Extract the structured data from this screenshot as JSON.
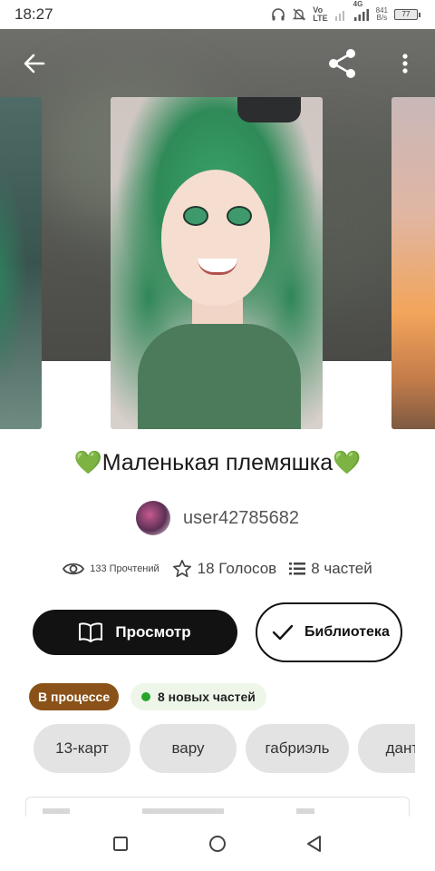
{
  "status_bar": {
    "time": "18:27",
    "volte": "Vo\nLTE",
    "network": "4G",
    "speed_value": "841",
    "speed_unit": "B/s",
    "battery": "77"
  },
  "story": {
    "title": "💚Маленькая племяшка💚",
    "author": "user42785682",
    "reads": "133 Прочтений",
    "votes": "18 Голосов",
    "parts": "8 частей"
  },
  "actions": {
    "read_label": "Просмотр",
    "library_label": "Библиотека"
  },
  "badges": {
    "status": "В процессе",
    "new_parts": "8 новых частей",
    "status_color": "#8a5218",
    "new_dot_color": "#27a52b"
  },
  "tags": [
    "13-карт",
    "вару",
    "габриэль",
    "данте"
  ],
  "icons": {
    "back": "back-arrow-icon",
    "share": "share-icon",
    "more": "more-vertical-icon",
    "views": "eye-icon",
    "votes": "star-icon",
    "parts": "list-icon",
    "read": "open-book-icon",
    "library": "checkmark-icon"
  }
}
